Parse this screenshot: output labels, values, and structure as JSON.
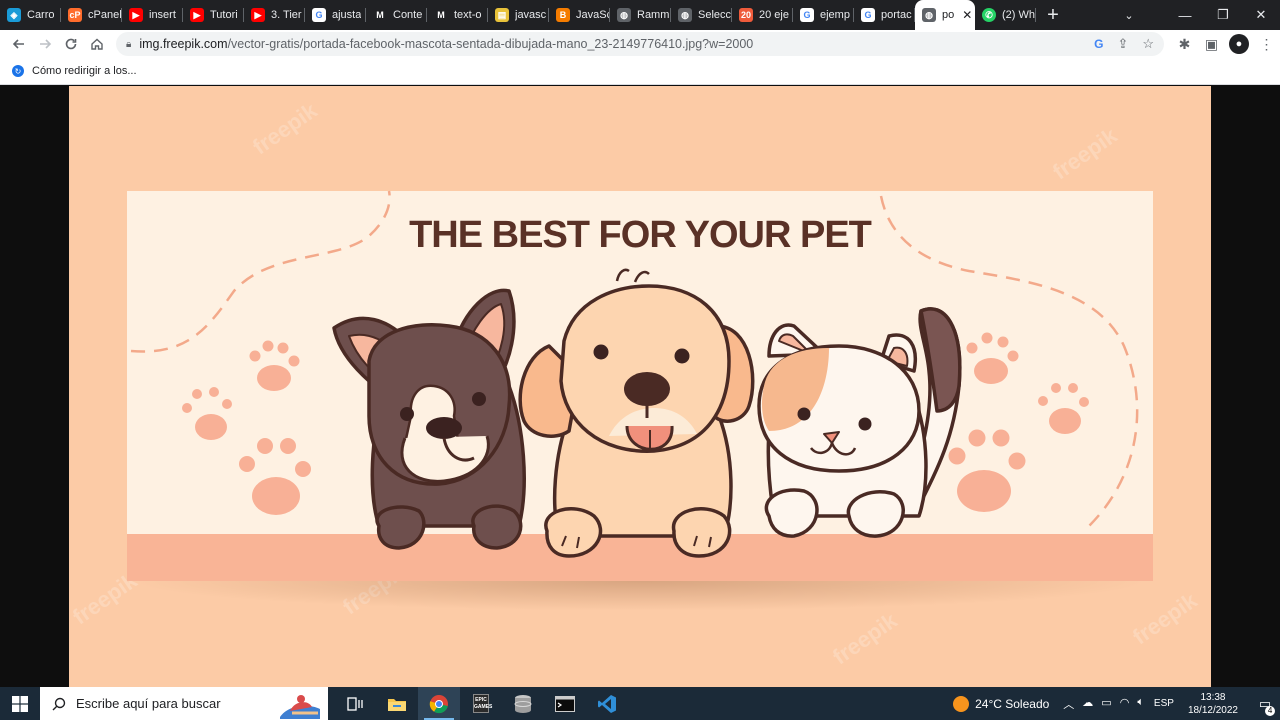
{
  "browser": {
    "tabs": [
      {
        "title": "Carro",
        "fav_color": "#1a9bd7",
        "fav_glyph": "◈"
      },
      {
        "title": "cPanel",
        "fav_color": "#ff6c2c",
        "fav_glyph": "cP"
      },
      {
        "title": "insert",
        "fav_color": "#ff0000",
        "fav_glyph": "▶"
      },
      {
        "title": "Tutori",
        "fav_color": "#ff0000",
        "fav_glyph": "▶"
      },
      {
        "title": "3. Tier",
        "fav_color": "#ff0000",
        "fav_glyph": "▶"
      },
      {
        "title": "ajusta",
        "fav_color": "#ffffff",
        "fav_glyph": "G"
      },
      {
        "title": "Conte",
        "fav_color": "#202124",
        "fav_glyph": "M"
      },
      {
        "title": "text-o",
        "fav_color": "#202124",
        "fav_glyph": "M"
      },
      {
        "title": "javasc",
        "fav_color": "#e8c23a",
        "fav_glyph": "▤"
      },
      {
        "title": "JavaSc",
        "fav_color": "#f57c00",
        "fav_glyph": "B"
      },
      {
        "title": "Ramm",
        "fav_color": "#5f6368",
        "fav_glyph": "◍"
      },
      {
        "title": "Selecc",
        "fav_color": "#5f6368",
        "fav_glyph": "◍"
      },
      {
        "title": "20 eje",
        "fav_color": "#ef5b3b",
        "fav_glyph": "20"
      },
      {
        "title": "ejemp",
        "fav_color": "#ffffff",
        "fav_glyph": "G"
      },
      {
        "title": "portac",
        "fav_color": "#ffffff",
        "fav_glyph": "G"
      }
    ],
    "active_tab": {
      "title": "po",
      "close": "✕"
    },
    "after_tab": {
      "title": "(2) Wh",
      "fav_color": "#25d366",
      "fav_glyph": "✆"
    },
    "new_tab": "+",
    "window_controls": {
      "chevron": "⌄",
      "minimize": "—",
      "restore": "❐",
      "close": "✕"
    },
    "url_host": "img.freepik.com",
    "url_path": "/vector-gratis/portada-facebook-mascota-sentada-dibujada-mano_23-2149776410.jpg?w=2000",
    "bookmark": {
      "label": "Cómo redirigir a los..."
    }
  },
  "artwork": {
    "headline": "THE BEST FOR YOUR PET",
    "watermark": "freepik",
    "colors": {
      "background": "#fccba6",
      "banner": "#fef1e2",
      "strip": "#f9b496",
      "outline": "#4a2a24",
      "paw": "#f8b096"
    }
  },
  "taskbar": {
    "search_placeholder": "Escribe aquí para buscar",
    "weather": "24°C  Soleado",
    "lang": "ESP",
    "time": "13:38",
    "date": "18/12/2022",
    "notif_count": "4"
  }
}
